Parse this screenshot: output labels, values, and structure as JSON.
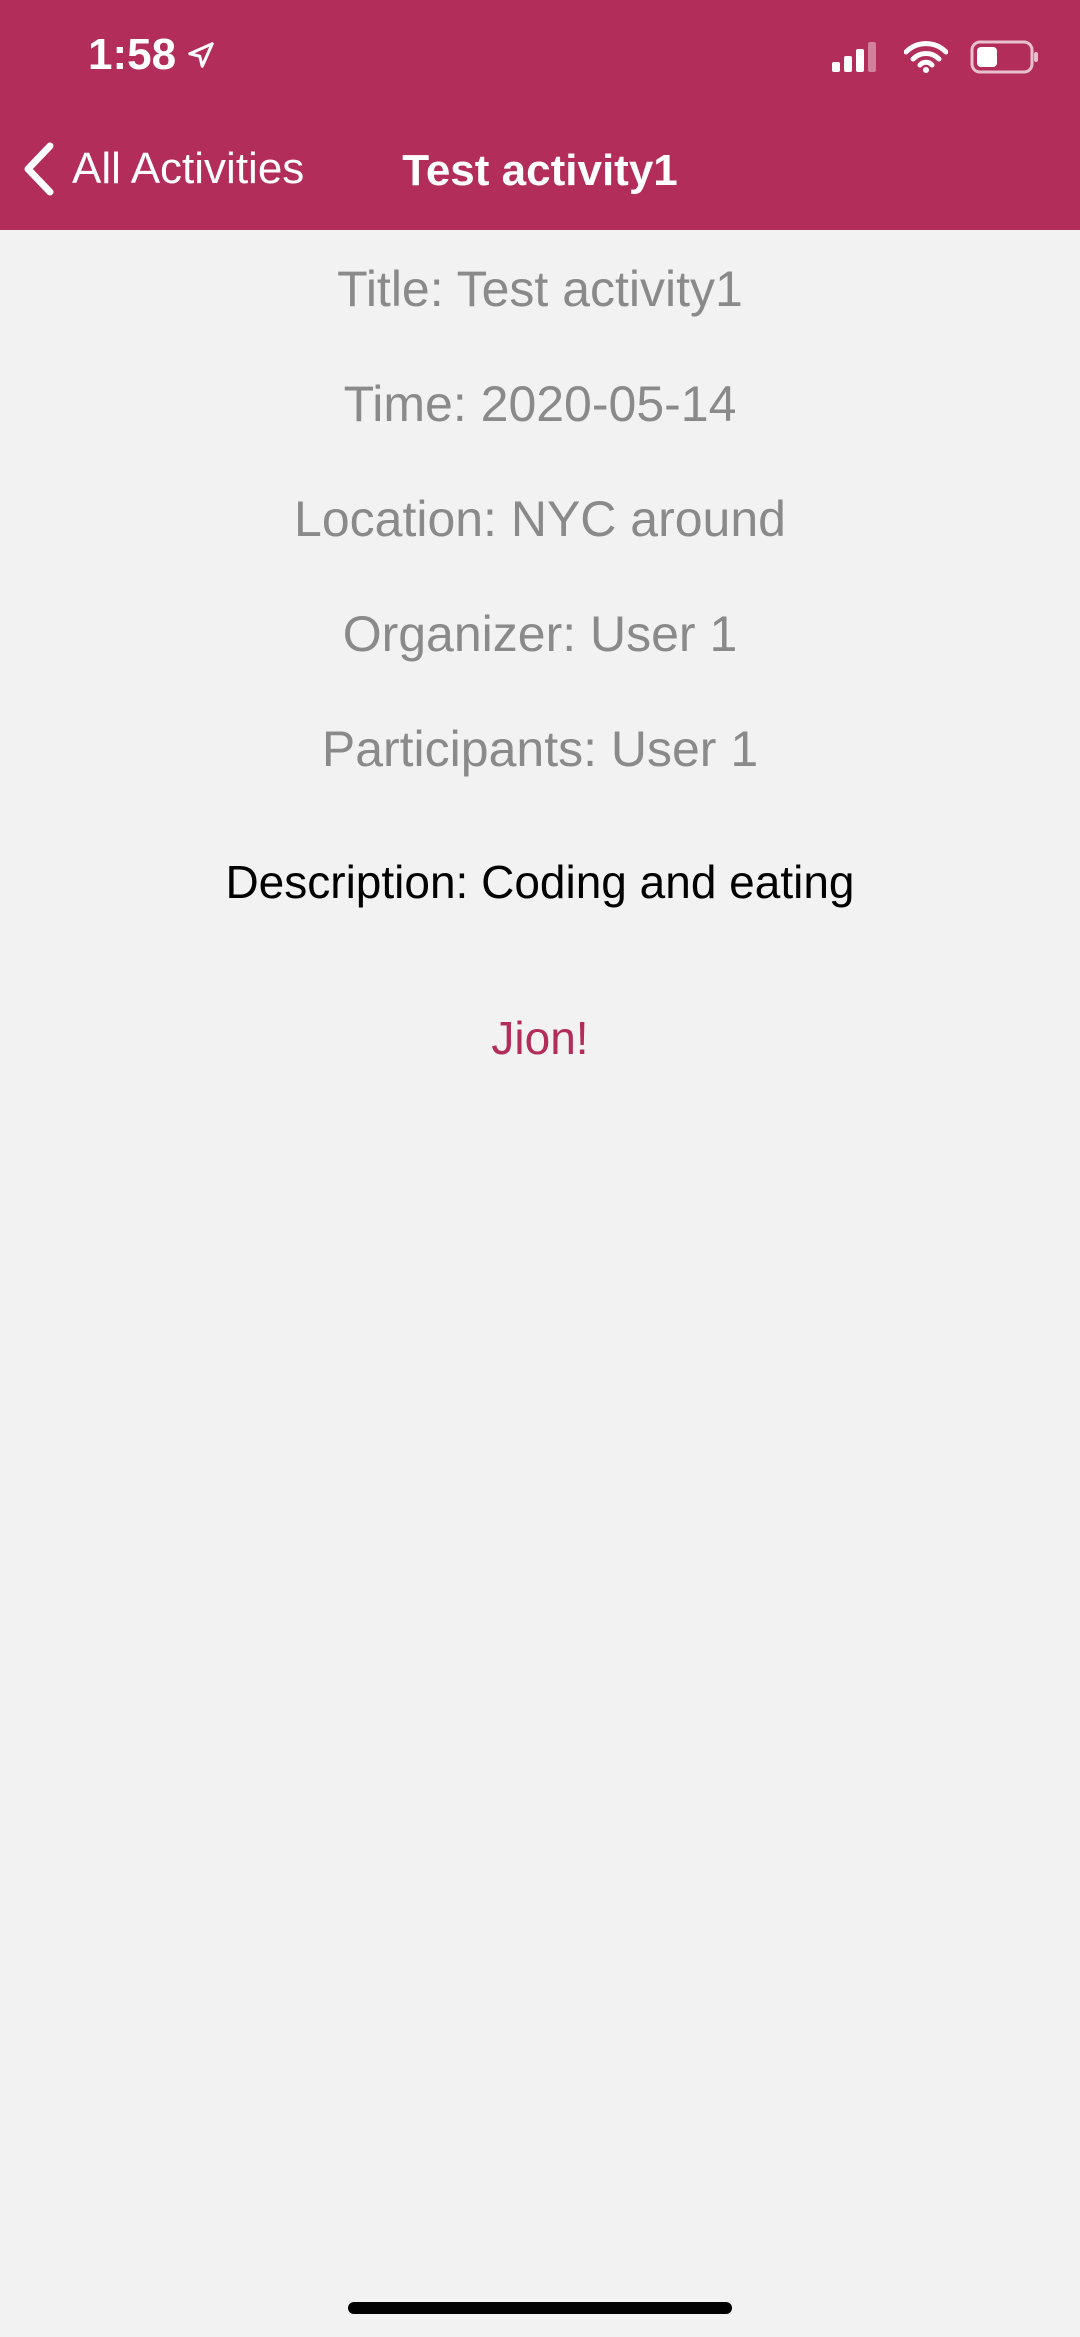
{
  "status_bar": {
    "time": "1:58"
  },
  "nav": {
    "back_label": "All Activities",
    "title": "Test activity1"
  },
  "details": {
    "title": "Title: Test activity1",
    "time": "Time: 2020-05-14",
    "location": "Location: NYC around",
    "organizer": "Organizer: User 1",
    "participants": "Participants: User 1",
    "description": "Description: Coding and eating"
  },
  "actions": {
    "join_label": "Jion!"
  },
  "colors": {
    "accent": "#b22d5a",
    "background": "#f2f2f2",
    "muted_text": "#8a8a8a"
  },
  "icons": {
    "location": "location-arrow-icon",
    "signal": "cellular-signal-icon",
    "wifi": "wifi-icon",
    "battery": "battery-icon",
    "back": "chevron-left-icon"
  }
}
